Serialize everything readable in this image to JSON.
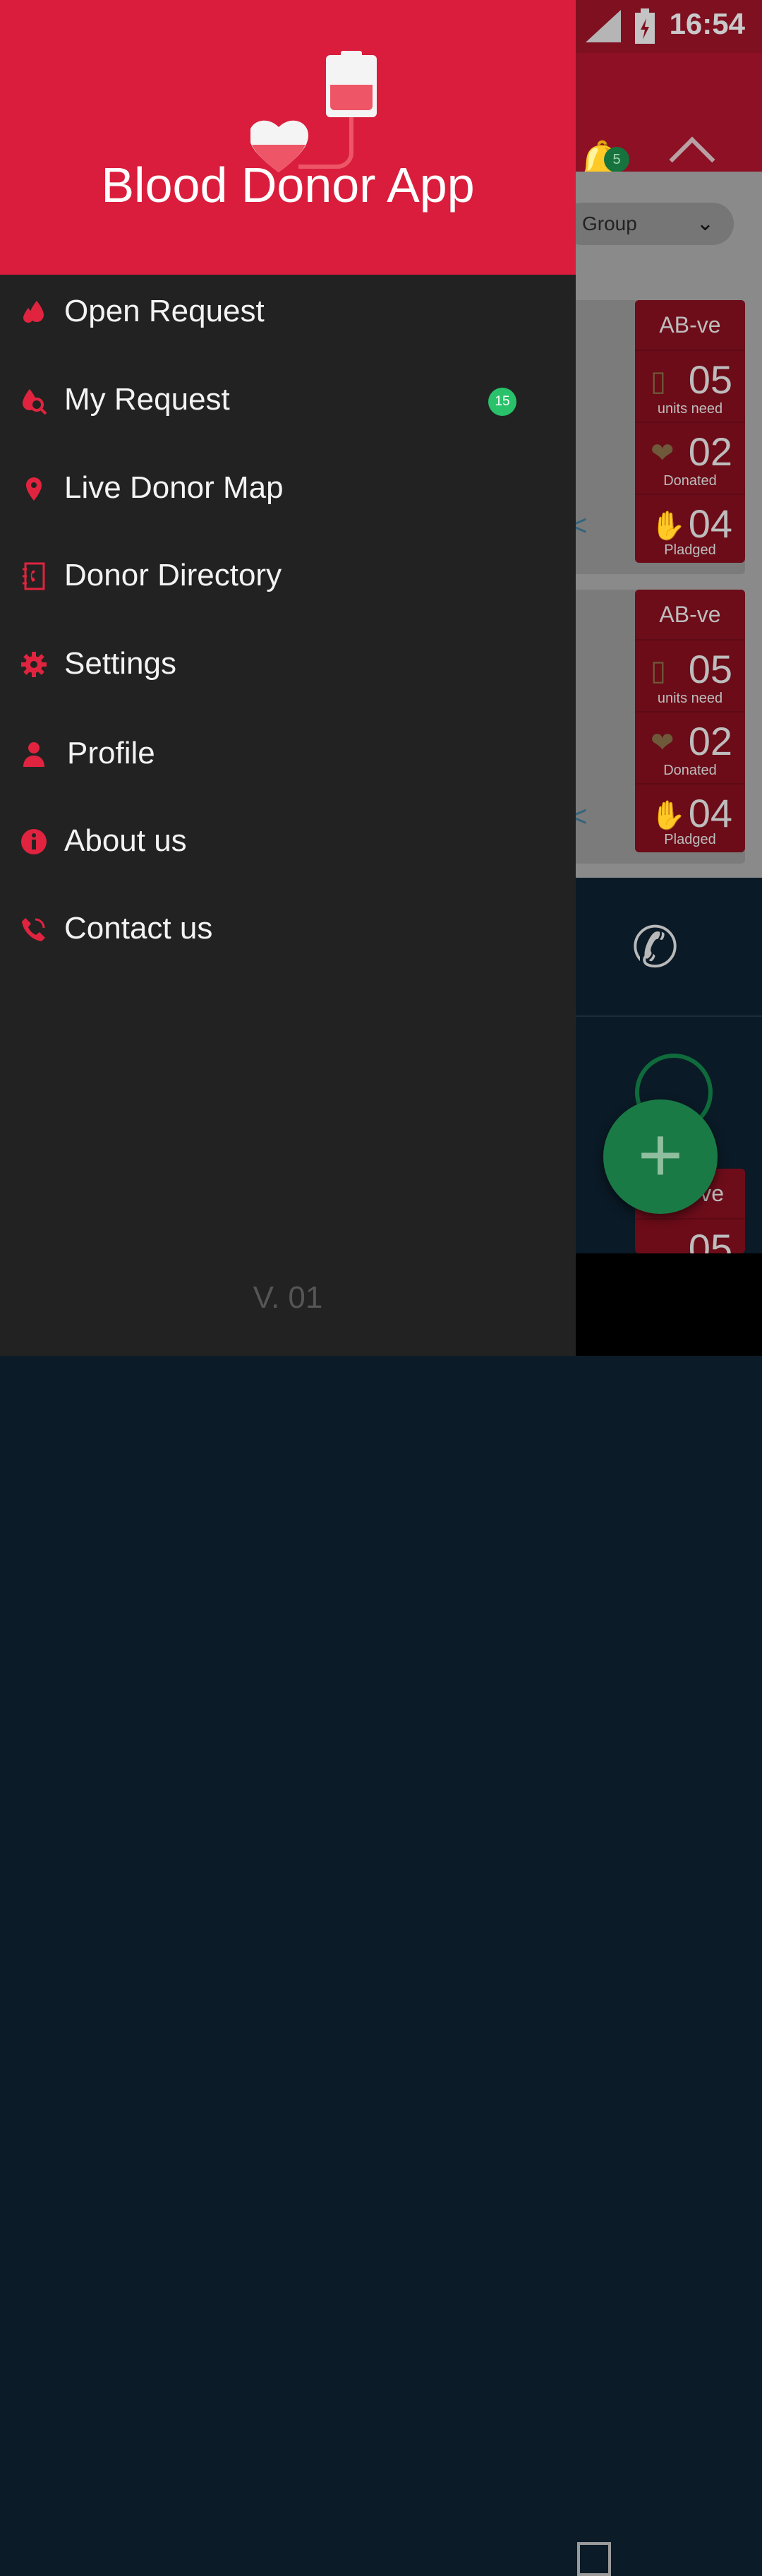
{
  "status": {
    "time": "16:54"
  },
  "background": {
    "filter_group_placeholder": "Group",
    "notification_count": "5",
    "requests": [
      {
        "blood_group": "AB-ve",
        "units_need": "05",
        "units_need_label": "units need",
        "donated": "02",
        "donated_label": "Donated",
        "pledged": "04",
        "pledged_label": "Pladged"
      },
      {
        "blood_group": "AB-ve",
        "units_need": "05",
        "units_need_label": "units need",
        "donated": "02",
        "donated_label": "Donated",
        "pledged": "04",
        "pledged_label": "Pladged"
      },
      {
        "blood_group_partial": "ve",
        "units_need": "05"
      }
    ]
  },
  "drawer": {
    "app_title": "Blood Donor App",
    "menu": [
      {
        "label": "Open Request",
        "icon": "blood-drops-icon"
      },
      {
        "label": "My Request",
        "icon": "blood-search-icon",
        "badge": "15"
      },
      {
        "label": "Live Donor Map",
        "icon": "map-pin-icon"
      },
      {
        "label": "Donor Directory",
        "icon": "phone-book-icon"
      },
      {
        "label": "Settings",
        "icon": "gear-icon"
      },
      {
        "label": "Profile",
        "icon": "person-icon"
      },
      {
        "label": "About us",
        "icon": "info-icon"
      },
      {
        "label": "Contact us",
        "icon": "phone-icon"
      }
    ],
    "version": "V. 01"
  },
  "colors": {
    "primary": "#da1d3c",
    "drawer_bg": "#222222",
    "badge_green": "#29c26b"
  }
}
